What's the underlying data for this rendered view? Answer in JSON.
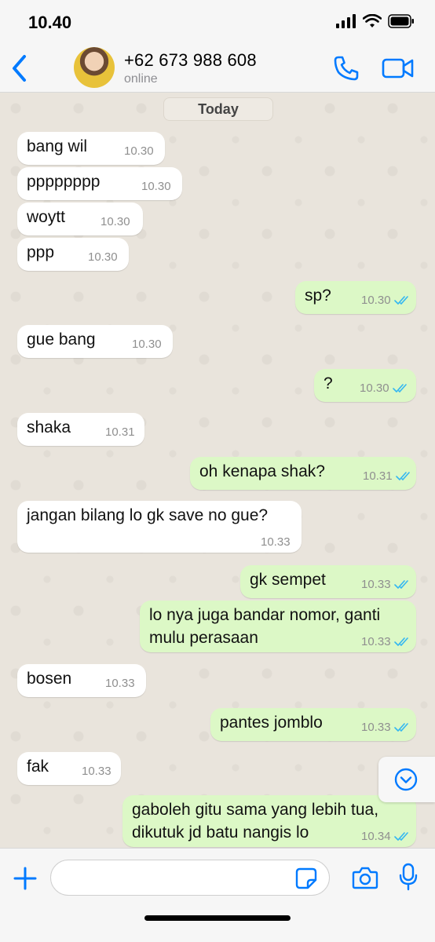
{
  "status_bar": {
    "time": "10.40"
  },
  "header": {
    "contact_name": "+62 673 988 608",
    "contact_status": "online"
  },
  "chat": {
    "date_label": "Today",
    "messages": [
      {
        "dir": "in",
        "text": "bang wil",
        "time": "10.30"
      },
      {
        "dir": "in",
        "text": "pppppppp",
        "time": "10.30"
      },
      {
        "dir": "in",
        "text": "woytt",
        "time": "10.30"
      },
      {
        "dir": "in",
        "text": "ppp",
        "time": "10.30"
      },
      {
        "dir": "out",
        "text": "sp?",
        "time": "10.30"
      },
      {
        "dir": "in",
        "text": "gue bang",
        "time": "10.30"
      },
      {
        "dir": "out",
        "text": "?",
        "time": "10.30"
      },
      {
        "dir": "in",
        "text": "shaka",
        "time": "10.31"
      },
      {
        "dir": "out",
        "text": "oh kenapa shak?",
        "time": "10.31"
      },
      {
        "dir": "in",
        "text": "jangan bilang lo gk save no gue?",
        "time": "10.33"
      },
      {
        "dir": "out",
        "text": "gk sempet",
        "time": "10.33"
      },
      {
        "dir": "out",
        "text": "lo nya juga bandar nomor, ganti mulu perasaan",
        "time": "10.33"
      },
      {
        "dir": "in",
        "text": "bosen",
        "time": "10.33"
      },
      {
        "dir": "out",
        "text": "pantes jomblo",
        "time": "10.33"
      },
      {
        "dir": "in",
        "text": "fak",
        "time": "10.33"
      },
      {
        "dir": "out",
        "text": "gaboleh gitu sama yang lebih tua, dikutuk jd batu nangis lo",
        "time": "10.34"
      }
    ]
  },
  "input_bar": {
    "placeholder": ""
  },
  "colors": {
    "accent": "#007aff",
    "incoming_bubble": "#ffffff",
    "outgoing_bubble": "#dcf8c6",
    "read_ticks": "#34b7f1"
  },
  "icons": [
    "back-chevron",
    "phone",
    "video-camera",
    "chevron-down-circle",
    "plus",
    "sticker",
    "camera",
    "microphone"
  ]
}
